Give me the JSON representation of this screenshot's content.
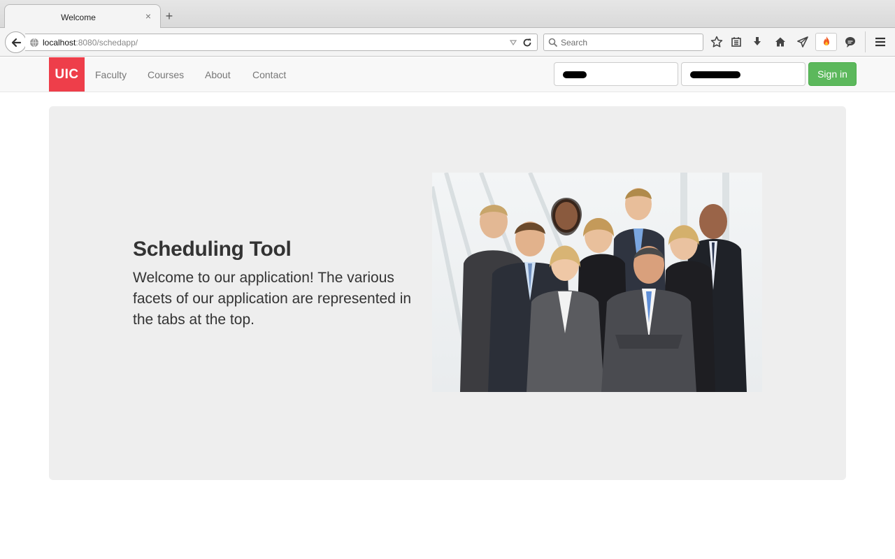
{
  "browser": {
    "tab_title": "Welcome",
    "tab_close": "×",
    "new_tab": "+",
    "url_host": "localhost",
    "url_rest": ":8080/schedapp/",
    "search_placeholder": "Search"
  },
  "site": {
    "brand": "UIC",
    "brand_color": "#ee3e4a",
    "nav": [
      "Faculty",
      "Courses",
      "About",
      "Contact"
    ],
    "signin_label": "Sign in",
    "signin_color": "#5cb85c"
  },
  "hero": {
    "title": "Scheduling Tool",
    "text": "Welcome to our application! The various facets of our application are represented in the tabs at the top."
  },
  "icons": [
    "back-arrow-icon",
    "globe-icon",
    "dropdown-icon",
    "reload-icon",
    "search-icon",
    "star-icon",
    "reading-list-icon",
    "download-icon",
    "home-icon",
    "send-icon",
    "fire-extension-icon",
    "chat-icon",
    "menu-icon"
  ]
}
